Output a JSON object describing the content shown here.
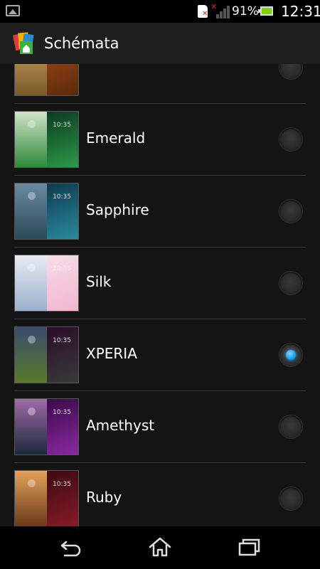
{
  "status_bar": {
    "battery_percent": "91%",
    "time": "12:31",
    "icons": [
      "gallery-icon",
      "sim-missing-icon",
      "signal-no-service-icon",
      "battery-icon"
    ]
  },
  "action_bar": {
    "title": "Schémata",
    "icon": "themes-app-icon"
  },
  "themes": [
    {
      "name": "",
      "time": "",
      "selected": false,
      "colors": {
        "left": [
          "#c9a25a",
          "#7a5a2a"
        ],
        "right": [
          "#a34a1a",
          "#5a2a0a"
        ]
      }
    },
    {
      "name": "Emerald",
      "time": "10:35",
      "selected": false,
      "colors": {
        "left": [
          "#cfe3c6",
          "#2f8a3a"
        ],
        "right": [
          "#0d3a20",
          "#2b9a4a"
        ]
      }
    },
    {
      "name": "Sapphire",
      "time": "10:35",
      "selected": false,
      "colors": {
        "left": [
          "#6a8aa0",
          "#2a4a5a"
        ],
        "right": [
          "#0e3a4e",
          "#2a8aa0"
        ]
      }
    },
    {
      "name": "Silk",
      "time": "10:35",
      "selected": false,
      "colors": {
        "left": [
          "#e7ebf2",
          "#9cb0cc"
        ],
        "right": [
          "#f6dce8",
          "#f2b5d0"
        ]
      }
    },
    {
      "name": "XPERIA",
      "time": "10:35",
      "selected": true,
      "colors": {
        "left": [
          "#3a4c6c",
          "#5a7a2a"
        ],
        "right": [
          "#2a0c2a",
          "#3a3a3a"
        ]
      }
    },
    {
      "name": "Amethyst",
      "time": "10:35",
      "selected": false,
      "colors": {
        "left": [
          "#a06aa8",
          "#1a2a3a"
        ],
        "right": [
          "#3a0a4a",
          "#8a2aa0"
        ]
      }
    },
    {
      "name": "Ruby",
      "time": "10:35",
      "selected": false,
      "colors": {
        "left": [
          "#e4a25a",
          "#6a3a1a"
        ],
        "right": [
          "#3a0a10",
          "#8a1a2a"
        ]
      }
    }
  ],
  "nav_bar": {
    "buttons": [
      "back-icon",
      "home-icon",
      "recent-apps-icon"
    ]
  },
  "accent_color": "#1ea3ee"
}
